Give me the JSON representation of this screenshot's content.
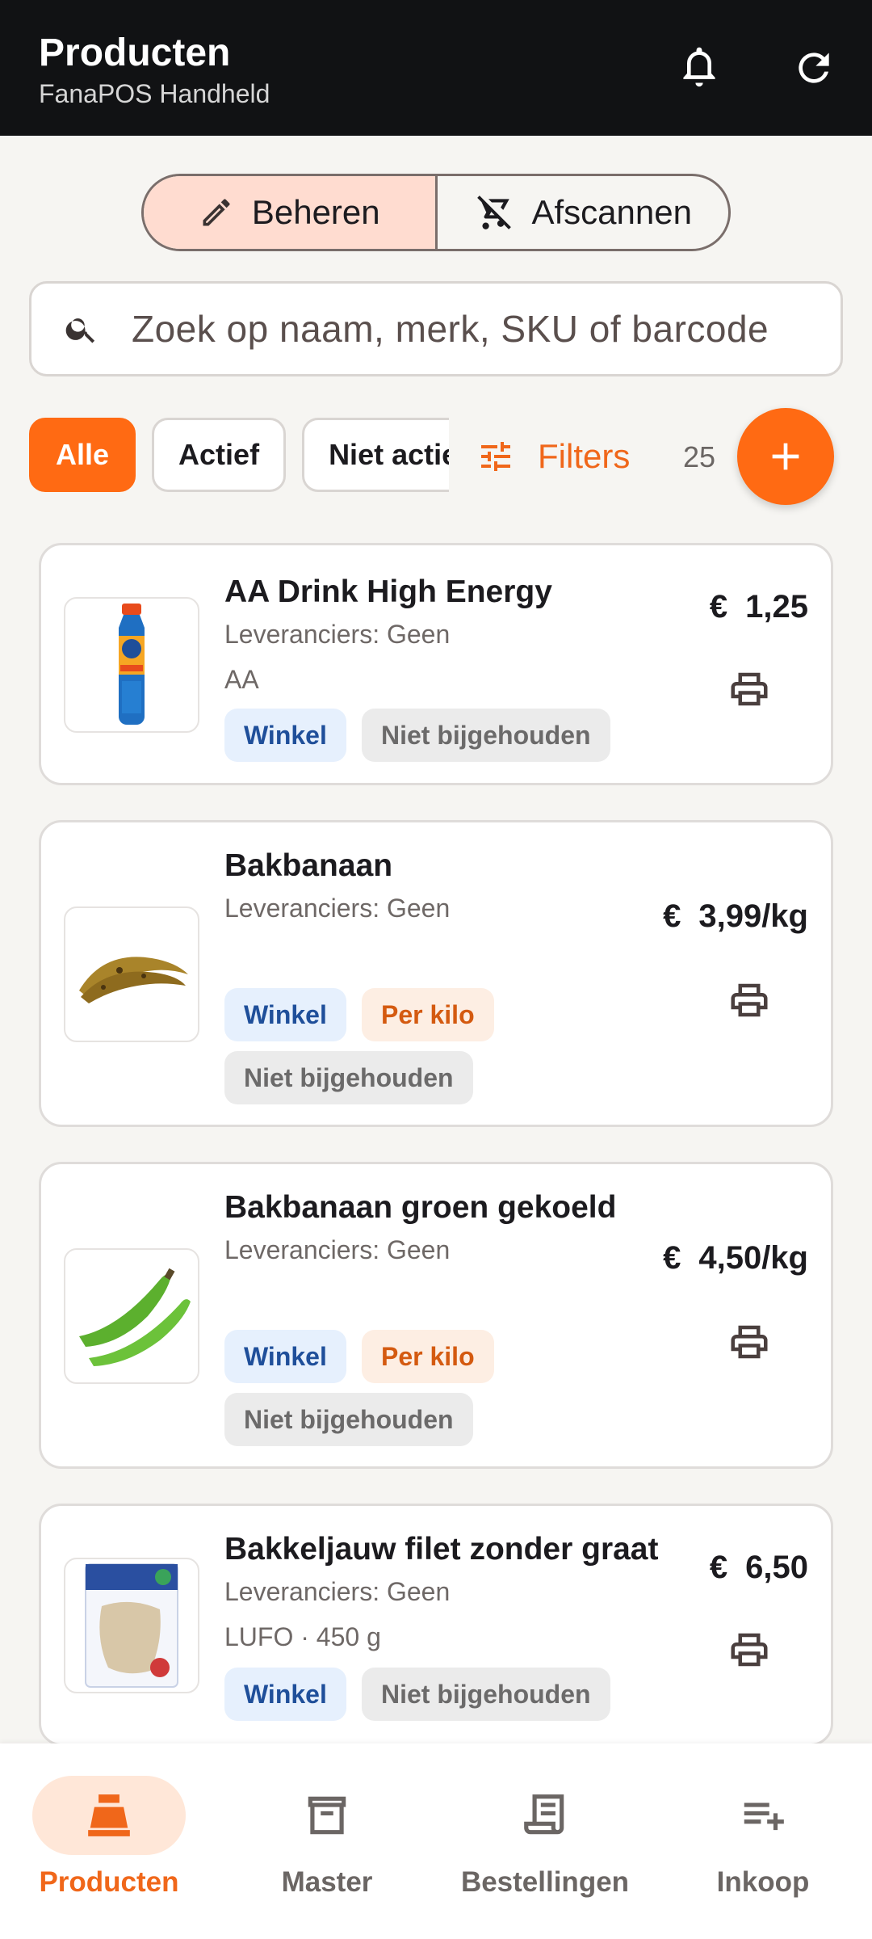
{
  "appbar": {
    "title": "Producten",
    "subtitle": "FanaPOS Handheld",
    "icons": [
      "bell-icon",
      "refresh-icon"
    ]
  },
  "mode_toggle": {
    "options": [
      {
        "label": "Beheren",
        "icon": "pencil-icon",
        "selected": true
      },
      {
        "label": "Afscannen",
        "icon": "cart-off-icon",
        "selected": false
      }
    ]
  },
  "search": {
    "placeholder": "Zoek op naam, merk, SKU of barcode",
    "icon": "search-icon"
  },
  "filters": {
    "chips": [
      {
        "label": "Alle",
        "active": true
      },
      {
        "label": "Actief",
        "active": false
      },
      {
        "label": "Niet actief",
        "active": false
      }
    ],
    "filters_label": "Filters",
    "count": "25",
    "add_icon": "plus-icon"
  },
  "products": [
    {
      "name": "AA Drink High Energy",
      "suppliers": "Leveranciers: Geen",
      "meta": "AA",
      "currency": "€",
      "price": "1,25",
      "image": "energy-drink-bottle",
      "tags": [
        "Winkel",
        "Niet bijgehouden"
      ]
    },
    {
      "name": "Bakbanaan",
      "suppliers": "Leveranciers: Geen",
      "meta": "",
      "currency": "€",
      "price": "3,99/kg",
      "image": "ripe-plantain",
      "tags": [
        "Winkel",
        "Per kilo",
        "Niet bijgehouden"
      ]
    },
    {
      "name": "Bakbanaan groen gekoeld",
      "suppliers": "Leveranciers: Geen",
      "meta": "",
      "currency": "€",
      "price": "4,50/kg",
      "image": "green-plantain",
      "tags": [
        "Winkel",
        "Per kilo",
        "Niet bijgehouden"
      ]
    },
    {
      "name": "Bakkeljauw filet zonder graat",
      "suppliers": "Leveranciers: Geen",
      "meta": "LUFO · 450 g",
      "currency": "€",
      "price": "6,50",
      "image": "fish-fillet-package",
      "tags": [
        "Winkel",
        "Niet bijgehouden"
      ]
    }
  ],
  "bottom_nav": [
    {
      "label": "Producten",
      "icon": "cash-register-icon",
      "active": true
    },
    {
      "label": "Master",
      "icon": "archive-icon",
      "active": false
    },
    {
      "label": "Bestellingen",
      "icon": "receipt-icon",
      "active": false
    },
    {
      "label": "Inkoop",
      "icon": "playlist-add-icon",
      "active": false
    }
  ],
  "colors": {
    "accent": "#ff6a13",
    "appbar": "#111214",
    "tag_blue_bg": "#e6f0fd",
    "tag_orange_bg": "#fdeee3",
    "tag_grey_bg": "#ebebeb"
  }
}
